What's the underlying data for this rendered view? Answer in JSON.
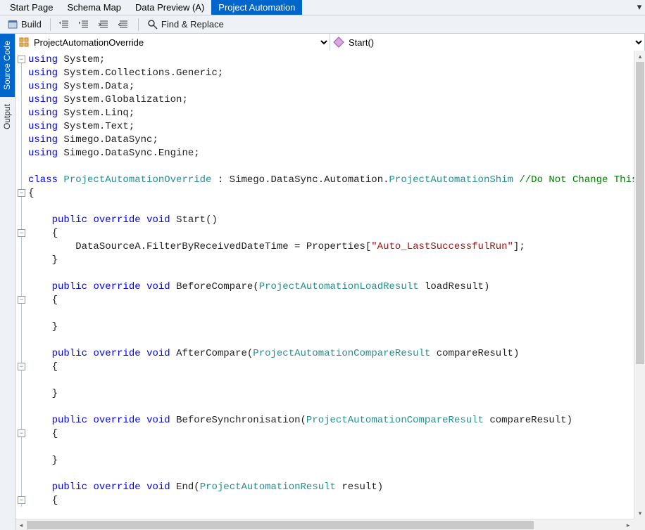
{
  "tabs": [
    {
      "label": "Start Page",
      "active": false
    },
    {
      "label": "Schema Map",
      "active": false
    },
    {
      "label": "Data Preview (A)",
      "active": false
    },
    {
      "label": "Project Automation",
      "active": true
    }
  ],
  "toolbar": {
    "build_label": "Build",
    "find_label": "Find & Replace"
  },
  "side_tabs": [
    {
      "label": "Source Code",
      "active": true
    },
    {
      "label": "Output",
      "active": false
    }
  ],
  "class_dropdown": {
    "icon": "class-icon",
    "value": "ProjectAutomationOverride"
  },
  "member_dropdown": {
    "icon": "method-icon",
    "value": "Start()"
  },
  "code": {
    "lines": [
      {
        "tokens": [
          {
            "t": "kw",
            "v": "using"
          },
          {
            "t": "",
            "v": " System;"
          }
        ]
      },
      {
        "tokens": [
          {
            "t": "kw",
            "v": "using"
          },
          {
            "t": "",
            "v": " System.Collections.Generic;"
          }
        ]
      },
      {
        "tokens": [
          {
            "t": "kw",
            "v": "using"
          },
          {
            "t": "",
            "v": " System.Data;"
          }
        ]
      },
      {
        "tokens": [
          {
            "t": "kw",
            "v": "using"
          },
          {
            "t": "",
            "v": " System.Globalization;"
          }
        ]
      },
      {
        "tokens": [
          {
            "t": "kw",
            "v": "using"
          },
          {
            "t": "",
            "v": " System.Linq;"
          }
        ]
      },
      {
        "tokens": [
          {
            "t": "kw",
            "v": "using"
          },
          {
            "t": "",
            "v": " System.Text;"
          }
        ]
      },
      {
        "tokens": [
          {
            "t": "kw",
            "v": "using"
          },
          {
            "t": "",
            "v": " Simego.DataSync;"
          }
        ]
      },
      {
        "tokens": [
          {
            "t": "kw",
            "v": "using"
          },
          {
            "t": "",
            "v": " Simego.DataSync.Engine;"
          }
        ]
      },
      {
        "tokens": [
          {
            "t": "",
            "v": ""
          }
        ]
      },
      {
        "tokens": [
          {
            "t": "kw",
            "v": "class"
          },
          {
            "t": "",
            "v": " "
          },
          {
            "t": "ty",
            "v": "ProjectAutomationOverride"
          },
          {
            "t": "",
            "v": " : Simego.DataSync.Automation."
          },
          {
            "t": "ty",
            "v": "ProjectAutomationShim"
          },
          {
            "t": "",
            "v": " "
          },
          {
            "t": "cm",
            "v": "//Do Not Change This Line"
          }
        ]
      },
      {
        "tokens": [
          {
            "t": "",
            "v": "{"
          }
        ]
      },
      {
        "tokens": [
          {
            "t": "",
            "v": ""
          }
        ]
      },
      {
        "tokens": [
          {
            "t": "",
            "v": "    "
          },
          {
            "t": "kw",
            "v": "public"
          },
          {
            "t": "",
            "v": " "
          },
          {
            "t": "kw",
            "v": "override"
          },
          {
            "t": "",
            "v": " "
          },
          {
            "t": "kw",
            "v": "void"
          },
          {
            "t": "",
            "v": " Start()"
          }
        ]
      },
      {
        "tokens": [
          {
            "t": "",
            "v": "    {"
          }
        ]
      },
      {
        "tokens": [
          {
            "t": "",
            "v": "        DataSourceA.FilterByReceivedDateTime = Properties["
          },
          {
            "t": "str",
            "v": "\"Auto_LastSuccessfulRun\""
          },
          {
            "t": "",
            "v": "];"
          }
        ]
      },
      {
        "tokens": [
          {
            "t": "",
            "v": "    }"
          }
        ]
      },
      {
        "tokens": [
          {
            "t": "",
            "v": ""
          }
        ]
      },
      {
        "tokens": [
          {
            "t": "",
            "v": "    "
          },
          {
            "t": "kw",
            "v": "public"
          },
          {
            "t": "",
            "v": " "
          },
          {
            "t": "kw",
            "v": "override"
          },
          {
            "t": "",
            "v": " "
          },
          {
            "t": "kw",
            "v": "void"
          },
          {
            "t": "",
            "v": " BeforeCompare("
          },
          {
            "t": "ty",
            "v": "ProjectAutomationLoadResult"
          },
          {
            "t": "",
            "v": " loadResult)"
          }
        ]
      },
      {
        "tokens": [
          {
            "t": "",
            "v": "    {"
          }
        ]
      },
      {
        "tokens": [
          {
            "t": "",
            "v": ""
          }
        ]
      },
      {
        "tokens": [
          {
            "t": "",
            "v": "    }"
          }
        ]
      },
      {
        "tokens": [
          {
            "t": "",
            "v": ""
          }
        ]
      },
      {
        "tokens": [
          {
            "t": "",
            "v": "    "
          },
          {
            "t": "kw",
            "v": "public"
          },
          {
            "t": "",
            "v": " "
          },
          {
            "t": "kw",
            "v": "override"
          },
          {
            "t": "",
            "v": " "
          },
          {
            "t": "kw",
            "v": "void"
          },
          {
            "t": "",
            "v": " AfterCompare("
          },
          {
            "t": "ty",
            "v": "ProjectAutomationCompareResult"
          },
          {
            "t": "",
            "v": " compareResult)"
          }
        ]
      },
      {
        "tokens": [
          {
            "t": "",
            "v": "    {"
          }
        ]
      },
      {
        "tokens": [
          {
            "t": "",
            "v": ""
          }
        ]
      },
      {
        "tokens": [
          {
            "t": "",
            "v": "    }"
          }
        ]
      },
      {
        "tokens": [
          {
            "t": "",
            "v": ""
          }
        ]
      },
      {
        "tokens": [
          {
            "t": "",
            "v": "    "
          },
          {
            "t": "kw",
            "v": "public"
          },
          {
            "t": "",
            "v": " "
          },
          {
            "t": "kw",
            "v": "override"
          },
          {
            "t": "",
            "v": " "
          },
          {
            "t": "kw",
            "v": "void"
          },
          {
            "t": "",
            "v": " BeforeSynchronisation("
          },
          {
            "t": "ty",
            "v": "ProjectAutomationCompareResult"
          },
          {
            "t": "",
            "v": " compareResult)"
          }
        ]
      },
      {
        "tokens": [
          {
            "t": "",
            "v": "    {"
          }
        ]
      },
      {
        "tokens": [
          {
            "t": "",
            "v": ""
          }
        ]
      },
      {
        "tokens": [
          {
            "t": "",
            "v": "    }"
          }
        ]
      },
      {
        "tokens": [
          {
            "t": "",
            "v": ""
          }
        ]
      },
      {
        "tokens": [
          {
            "t": "",
            "v": "    "
          },
          {
            "t": "kw",
            "v": "public"
          },
          {
            "t": "",
            "v": " "
          },
          {
            "t": "kw",
            "v": "override"
          },
          {
            "t": "",
            "v": " "
          },
          {
            "t": "kw",
            "v": "void"
          },
          {
            "t": "",
            "v": " End("
          },
          {
            "t": "ty",
            "v": "ProjectAutomationResult"
          },
          {
            "t": "",
            "v": " result)"
          }
        ]
      },
      {
        "tokens": [
          {
            "t": "",
            "v": "    {"
          }
        ]
      }
    ],
    "fold_markers": [
      {
        "line": 0,
        "sym": "−"
      },
      {
        "line": 10,
        "sym": "−"
      },
      {
        "line": 13,
        "sym": "−"
      },
      {
        "line": 18,
        "sym": "−"
      },
      {
        "line": 23,
        "sym": "−"
      },
      {
        "line": 28,
        "sym": "−"
      },
      {
        "line": 33,
        "sym": "−"
      }
    ]
  }
}
